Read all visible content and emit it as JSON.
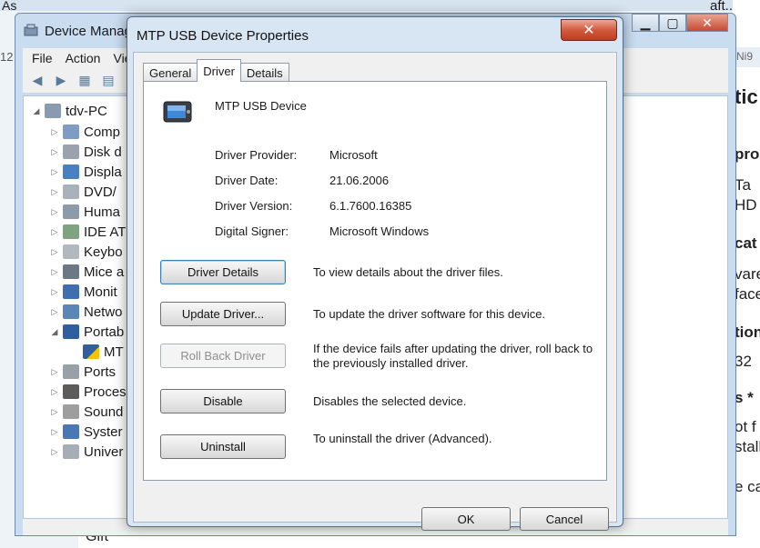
{
  "device_manager": {
    "title": "Device Manag",
    "menu": [
      "File",
      "Action",
      "View"
    ],
    "tree": {
      "root": "tdv-PC",
      "items": [
        "Comp",
        "Disk d",
        "Displa",
        "DVD/",
        "Huma",
        "IDE AT",
        "Keybo",
        "Mice a",
        "Monit",
        "Netwo",
        "Portab",
        "MT",
        "Ports",
        "Proces",
        "Sound",
        "Syster",
        "Univer"
      ]
    }
  },
  "background": {
    "right_text": [
      "tic",
      "pro",
      "Ta",
      "HD",
      "cat",
      "vare",
      "face",
      "tion",
      "32",
      "s *",
      "ot f",
      "stall",
      "e ca"
    ],
    "top_left_text": "As",
    "left_text": "12",
    "tab_right_text": "Ni9",
    "top_right_text": "aft...",
    "bottom_text": "Gift"
  },
  "dialog": {
    "title": "MTP USB Device Properties",
    "tabs": [
      "General",
      "Driver",
      "Details"
    ],
    "active_tab": "Driver",
    "device_name": "MTP USB Device",
    "info": [
      {
        "label": "Driver Provider:",
        "value": "Microsoft"
      },
      {
        "label": "Driver Date:",
        "value": "21.06.2006"
      },
      {
        "label": "Driver Version:",
        "value": "6.1.7600.16385"
      },
      {
        "label": "Digital Signer:",
        "value": "Microsoft Windows"
      }
    ],
    "actions": [
      {
        "button": "Driver Details",
        "description": "To view details about the driver files."
      },
      {
        "button": "Update Driver...",
        "description": "To update the driver software for this device."
      },
      {
        "button": "Roll Back Driver",
        "description": "If the device fails after updating the driver, roll back to the previously installed driver."
      },
      {
        "button": "Disable",
        "description": "Disables the selected device."
      },
      {
        "button": "Uninstall",
        "description": "To uninstall the driver (Advanced)."
      }
    ],
    "ok_label": "OK",
    "cancel_label": "Cancel",
    "close_glyph": "✕"
  }
}
